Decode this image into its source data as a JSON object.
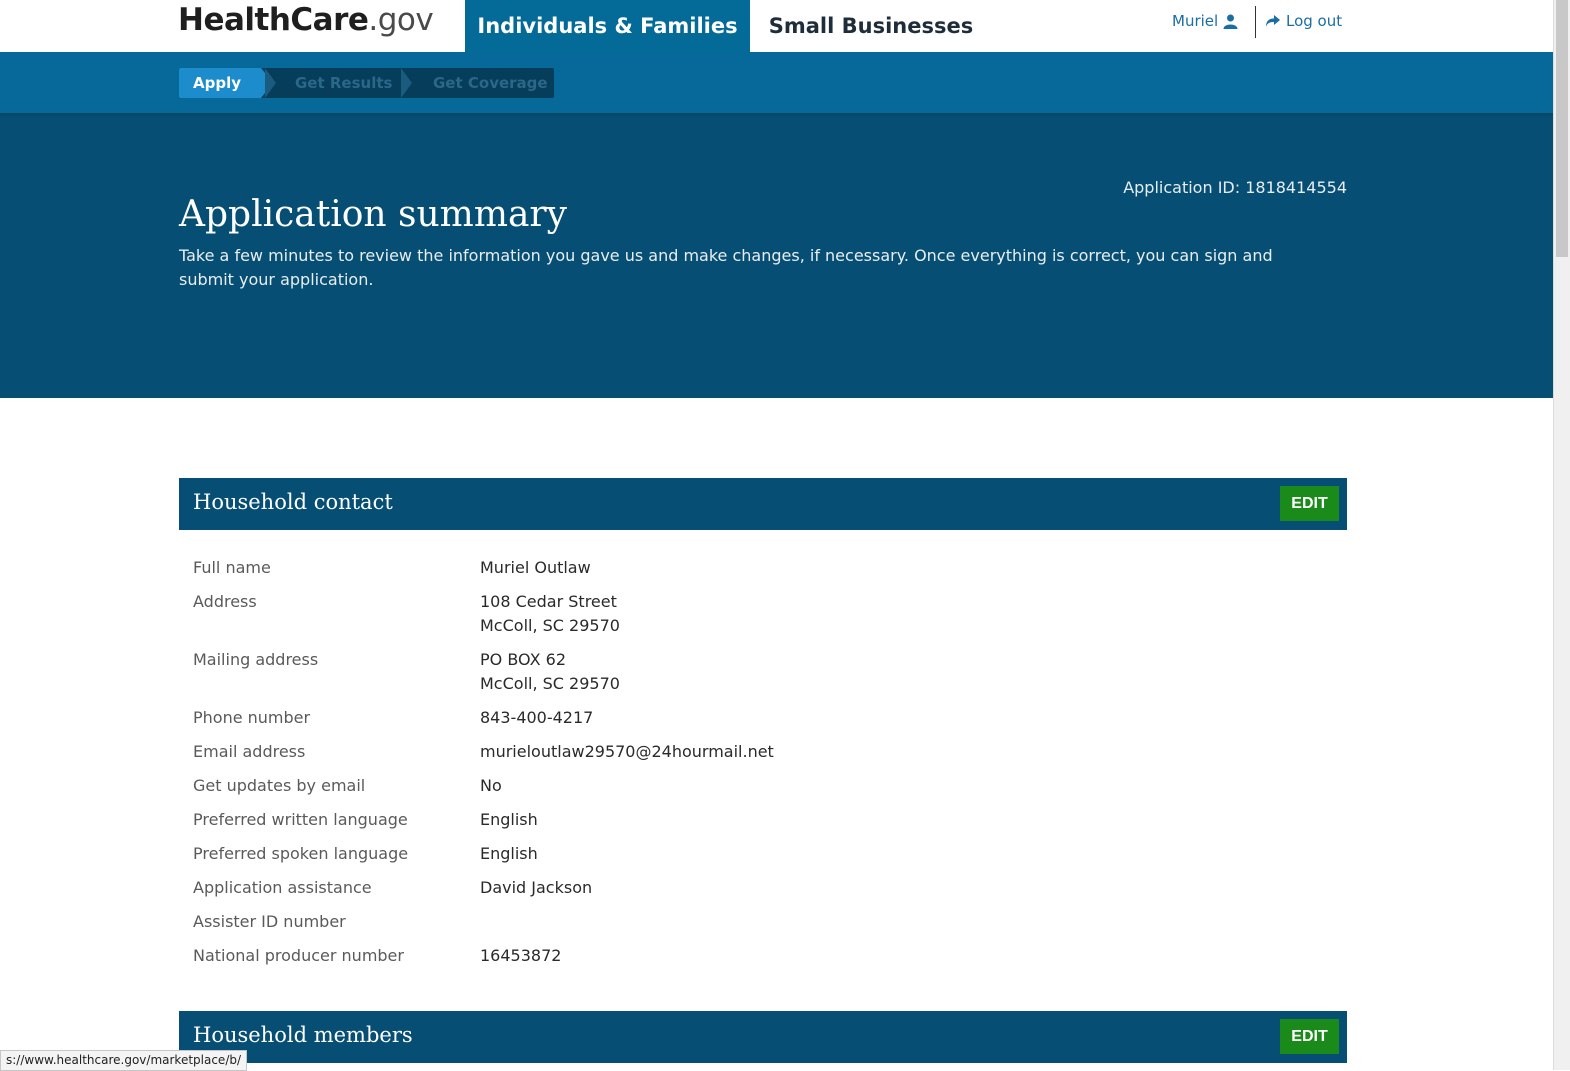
{
  "header": {
    "logo_main": "HealthCare",
    "logo_suffix": ".gov",
    "nav_active": "Individuals & Families",
    "nav_other": "Small Businesses",
    "user_name": "Muriel",
    "logout_label": "Log out"
  },
  "steps": [
    "Apply",
    "Get Results",
    "Get Coverage"
  ],
  "hero": {
    "application_id": "Application ID: 1818414554",
    "title": "Application summary",
    "description": "Take a few minutes to review the information you gave us and make changes, if necessary. Once everything is correct, you can sign and submit your application."
  },
  "household_contact": {
    "title": "Household contact",
    "edit_label": "EDIT",
    "rows": [
      {
        "label": "Full name",
        "value": "Muriel Outlaw"
      },
      {
        "label": "Address",
        "value_line1": "108 Cedar Street",
        "value_line2": "McColl, SC 29570"
      },
      {
        "label": "Mailing address",
        "value_line1": "PO BOX 62",
        "value_line2": "McColl, SC 29570"
      },
      {
        "label": "Phone number",
        "value": "843-400-4217"
      },
      {
        "label": "Email address",
        "value": "murieloutlaw29570@24hourmail.net"
      },
      {
        "label": "Get updates by email",
        "value": "No"
      },
      {
        "label": "Preferred written language",
        "value": "English"
      },
      {
        "label": "Preferred spoken language",
        "value": "English"
      },
      {
        "label": "Application assistance",
        "value": "David Jackson"
      },
      {
        "label": "Assister ID number",
        "value": ""
      },
      {
        "label": "National producer number",
        "value": "16453872"
      }
    ]
  },
  "household_members": {
    "title": "Household members",
    "edit_label": "EDIT"
  },
  "status_bar": {
    "url": "s://www.healthcare.gov/marketplace/b/"
  }
}
